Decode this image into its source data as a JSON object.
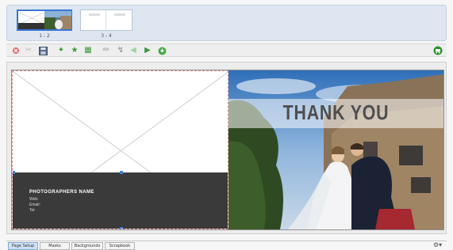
{
  "thumbnails": [
    {
      "label": "1 - 2",
      "selected": true
    },
    {
      "label": "3 - 4",
      "selected": false
    }
  ],
  "toolbar": {
    "icons": [
      "delete-icon",
      "scissors-icon",
      "save-icon",
      "arrange-icon",
      "person-icon",
      "print-icon",
      "pen-icon",
      "tool-icon",
      "arrow-left-icon",
      "arrow-right-icon",
      "help-icon",
      "cart-icon"
    ]
  },
  "left_page": {
    "name": "PHOTOGRAPHERS NAME",
    "web": "Web:",
    "email": "Email:",
    "tel": "Tel:"
  },
  "right_page": {
    "headline": "THANK YOU"
  },
  "tabs": [
    "Page Setup",
    "Masks",
    "Backgrounds",
    "Scrapbook"
  ],
  "active_tab": "Page Setup",
  "colors": {
    "selection": "#3a77d6",
    "dark_panel": "#3a3a3a",
    "toolbar_green": "#3a9a3a"
  }
}
